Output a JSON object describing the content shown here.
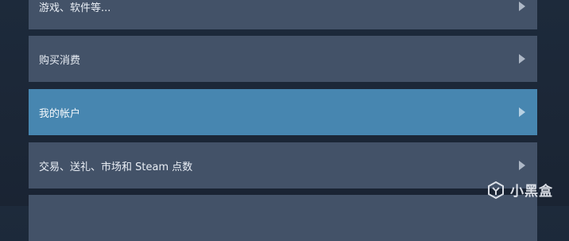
{
  "menu": {
    "items": [
      {
        "label": "游戏、软件等..."
      },
      {
        "label": "购买消费"
      },
      {
        "label": "我的帐户",
        "selected": true
      },
      {
        "label": "交易、送礼、市场和 Steam 点数"
      },
      {
        "label": ""
      }
    ]
  },
  "watermark": {
    "text": "小黑盒"
  },
  "colors": {
    "background": "#1b2838",
    "row": "#435268",
    "row_active": "#4786b0",
    "text": "#e9eef5"
  },
  "icons": {
    "row_arrow": "chevron-right-icon",
    "watermark_logo": "xiaoheihe-logo-icon"
  }
}
